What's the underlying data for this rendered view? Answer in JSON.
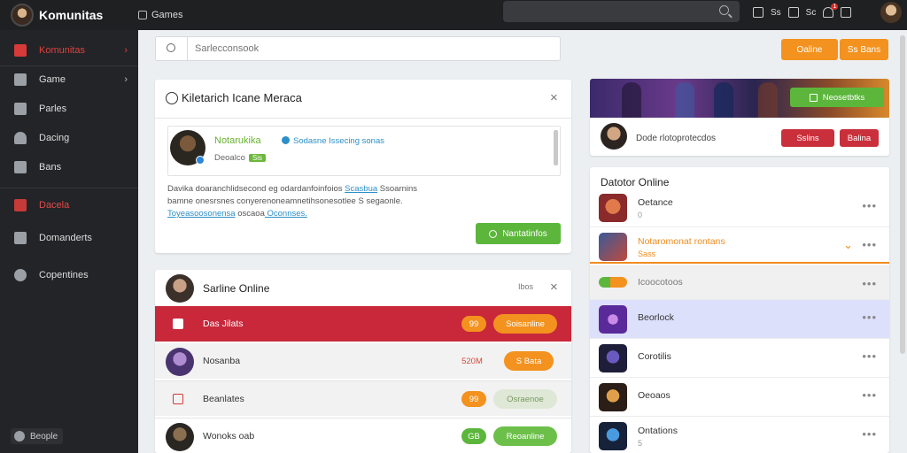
{
  "topbar": {
    "app_name": "Komunitas",
    "games_link": "Games",
    "icons_text": [
      "Ss",
      "Sc"
    ],
    "badge": "1"
  },
  "sidebar": {
    "items": [
      {
        "label": "Komunitas",
        "icon": "home-icon",
        "chevron": "›"
      },
      {
        "label": "Game",
        "icon": "book-icon",
        "chevron": "›"
      },
      {
        "label": "Parles",
        "icon": "pen-icon"
      },
      {
        "label": "Dacing",
        "icon": "user-icon"
      },
      {
        "label": "Bans",
        "icon": "phone-icon"
      },
      {
        "label": "Dacela",
        "icon": "mail-icon"
      },
      {
        "label": "Domanderts",
        "icon": "people-icon"
      },
      {
        "label": "Copentines",
        "icon": "globe-icon"
      }
    ],
    "footer": "Beople"
  },
  "search": {
    "placeholder": "Sarlecconsook",
    "btn1": "Oaline",
    "btn2": "Ss Bans"
  },
  "dialog": {
    "title": "Kiletarich Icane Meraca",
    "notif_name": "Notarukika",
    "notif_sub": "Sodasne Issecing sonas",
    "notif_meta": "Deoalco",
    "notif_tag": "Sis",
    "body_parts": [
      "Davika doaranchlidsecond eg odardanfoinfoios ",
      "Scasbua",
      " Ssoarnins",
      "bamne onesrsnes conyerenoneamnetihsonesotlee S segaonle.",
      "Toyeasoosonensa",
      " oscaoa",
      " Oconnses."
    ],
    "action": "Nantatinfos"
  },
  "friends": {
    "title": "Sarline Online",
    "meta": "Ibos",
    "rows": [
      {
        "label": "Das Jilats",
        "pill": "99",
        "btn": "Soisanline"
      },
      {
        "label": "Nosanba",
        "pill": "520M",
        "btn": "S Bata"
      },
      {
        "label": "Beanlates",
        "pill": "99",
        "btn": "Osraenoe"
      },
      {
        "label": "Wonoks oab",
        "pill": "GB",
        "btn": "Reoanline"
      }
    ]
  },
  "banner": {
    "button": "Neosetbtks"
  },
  "userbar": {
    "text": "Dode rlotoprotecdos",
    "btn1": "Sslins",
    "btn2": "Balina"
  },
  "online": {
    "title": "Datotor Online",
    "rows": [
      {
        "name": "Oetance",
        "sub": "0"
      },
      {
        "name": "Notaromonat rontans",
        "sub": "Sass"
      },
      {
        "name": "Icoocotoos",
        "sub": ""
      },
      {
        "name": "Beorlock",
        "sub": ""
      },
      {
        "name": "Corotilis",
        "sub": ""
      },
      {
        "name": "Oeoaos",
        "sub": ""
      },
      {
        "name": "Ontations",
        "sub": "5"
      }
    ]
  },
  "colors": {
    "accent_orange": "#f3921f",
    "accent_green": "#5cb63b",
    "accent_red": "#c9303c",
    "sidebar": "#232427"
  }
}
